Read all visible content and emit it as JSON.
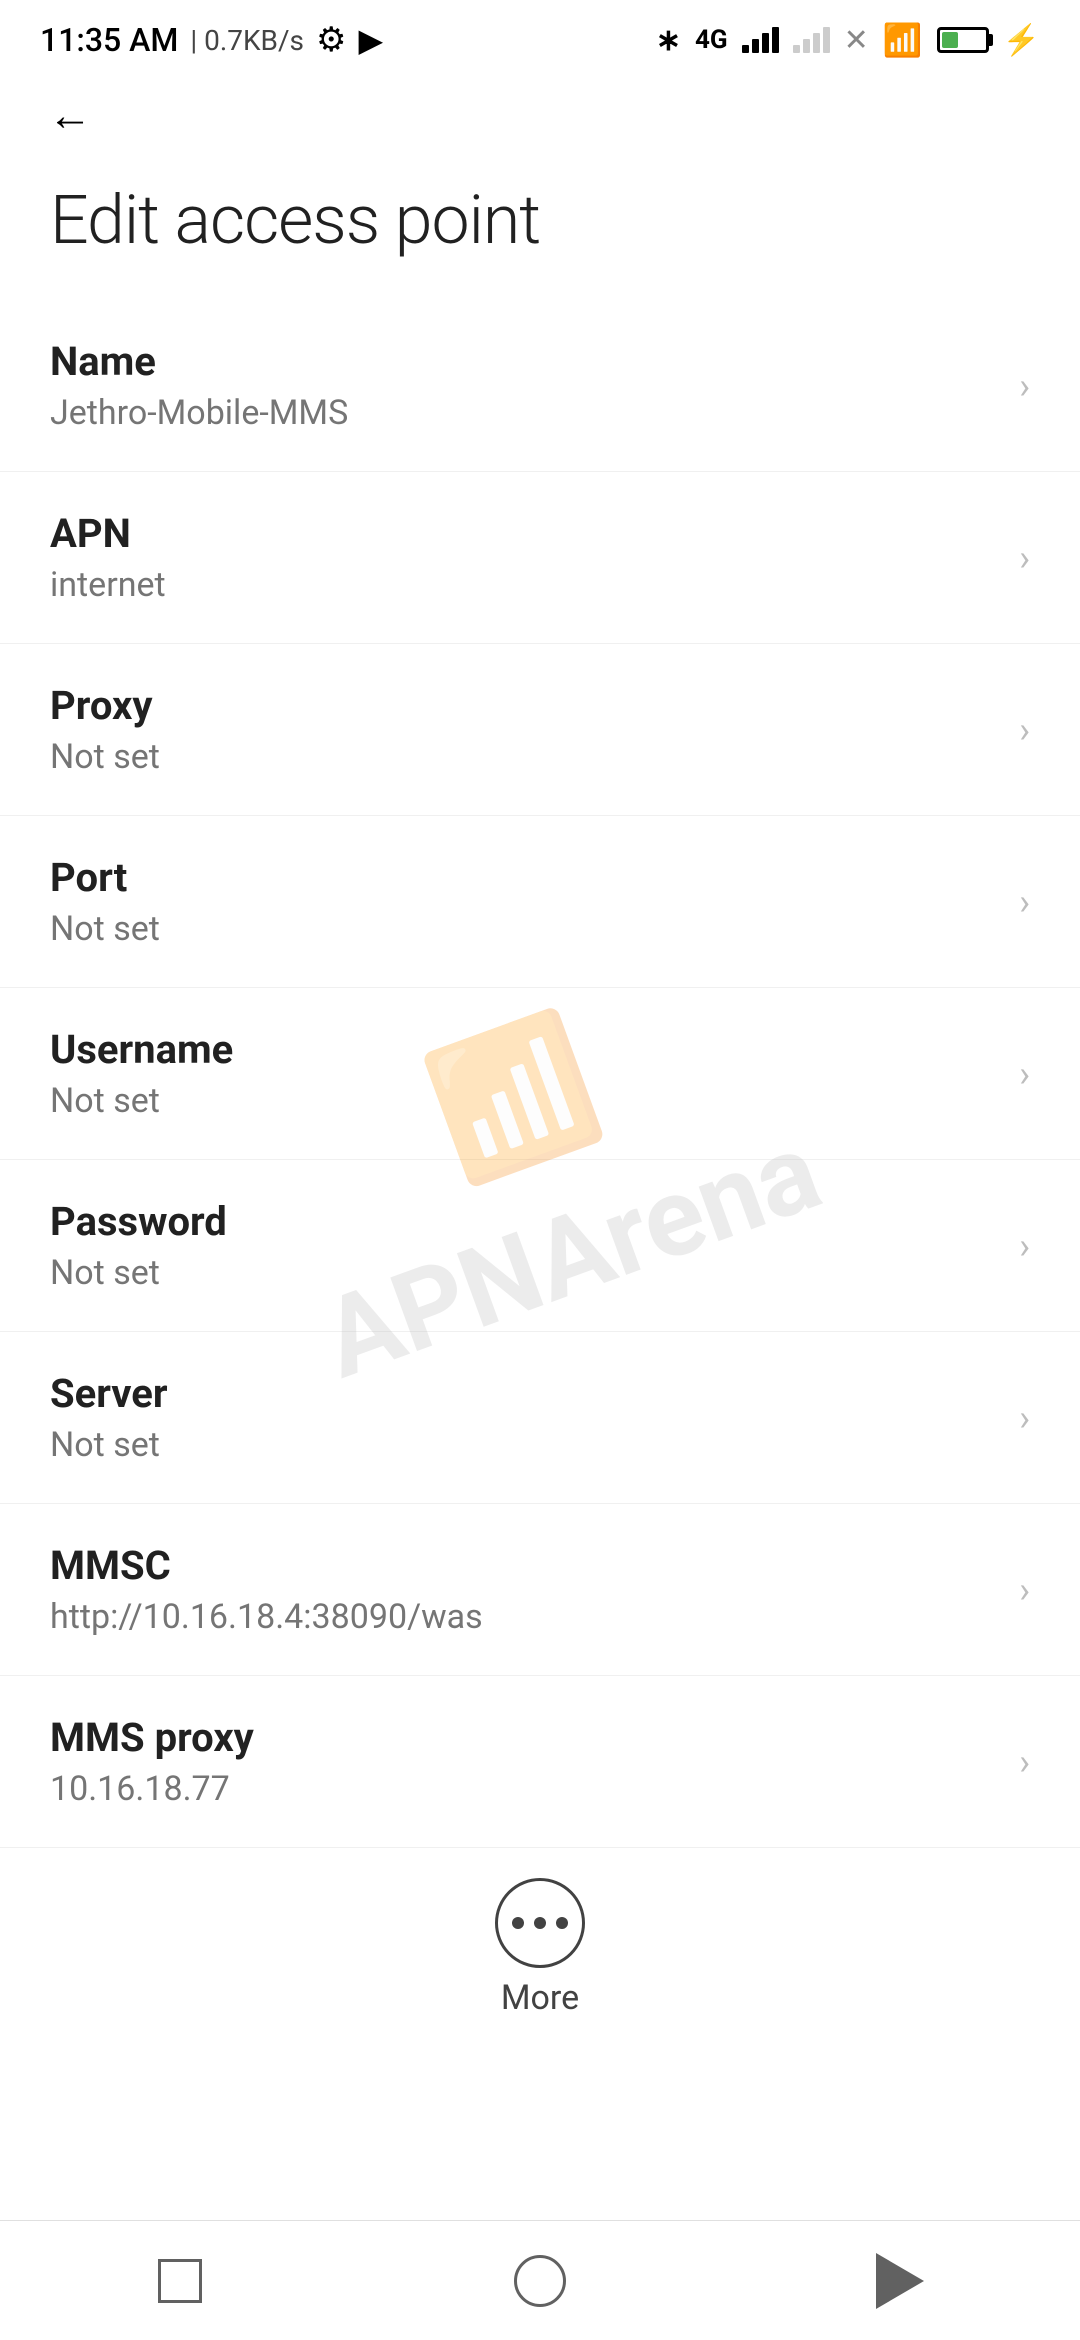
{
  "statusBar": {
    "time": "11:35 AM",
    "speed": "0.7KB/s"
  },
  "page": {
    "title": "Edit access point",
    "backLabel": "Back"
  },
  "settings": [
    {
      "label": "Name",
      "value": "Jethro-Mobile-MMS"
    },
    {
      "label": "APN",
      "value": "internet"
    },
    {
      "label": "Proxy",
      "value": "Not set"
    },
    {
      "label": "Port",
      "value": "Not set"
    },
    {
      "label": "Username",
      "value": "Not set"
    },
    {
      "label": "Password",
      "value": "Not set"
    },
    {
      "label": "Server",
      "value": "Not set"
    },
    {
      "label": "MMSC",
      "value": "http://10.16.18.4:38090/was"
    },
    {
      "label": "MMS proxy",
      "value": "10.16.18.77"
    }
  ],
  "more": {
    "label": "More"
  }
}
